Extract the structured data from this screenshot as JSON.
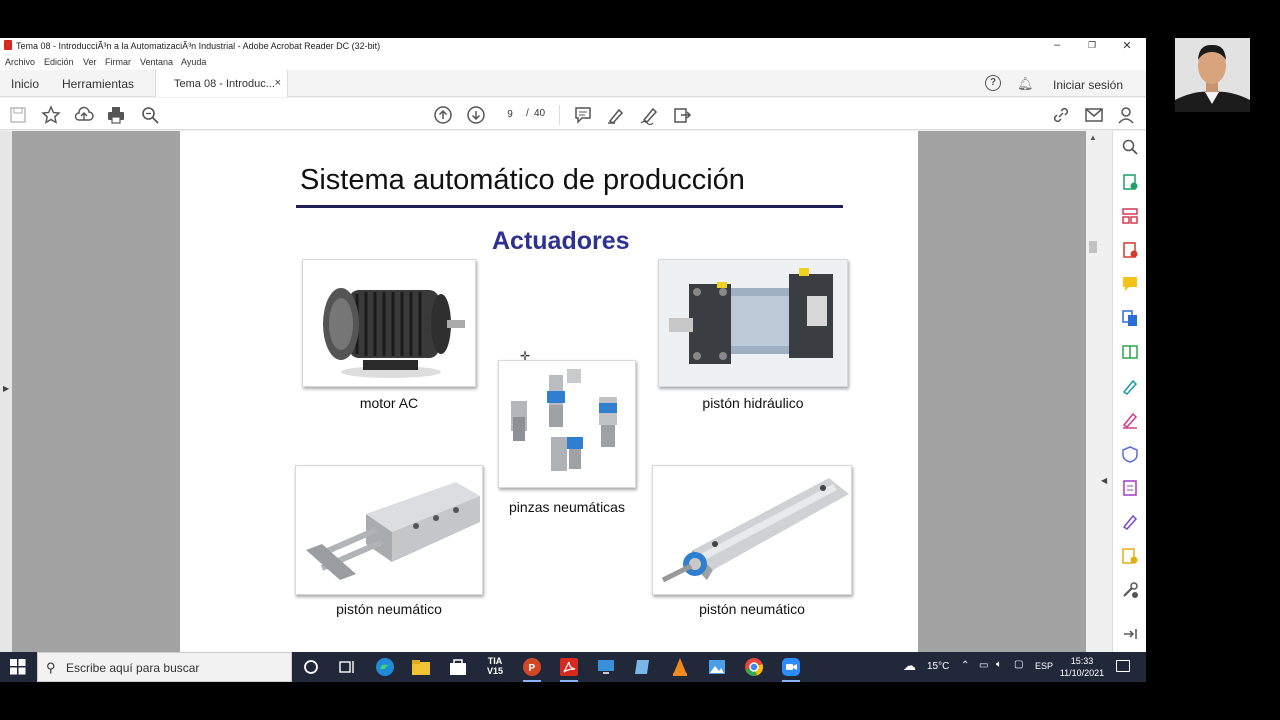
{
  "window": {
    "title": "Tema 08 - IntroducciÃ³n a la AutomatizaciÃ³n Industrial - Adobe Acrobat Reader DC (32-bit)",
    "controls": {
      "minimize": "–",
      "restore": "❐",
      "close": "✕"
    }
  },
  "menu": [
    "Archivo",
    "Edición",
    "Ver",
    "Firmar",
    "Ventana",
    "Ayuda"
  ],
  "tabs": {
    "home": "Inicio",
    "tools": "Herramientas",
    "document": "Tema 08 - Introduc...",
    "close": "×",
    "help": "?",
    "login": "Iniciar sesión"
  },
  "toolbar": {
    "current_page": "9",
    "separator": "/",
    "total_pages": "40"
  },
  "slide": {
    "title": "Sistema automático de producción",
    "section": "Actuadores",
    "captions": {
      "motor": "motor AC",
      "hydraulic": "pistón hidráulico",
      "grippers": "pinzas neumáticas",
      "pneumatic_left": "pistón neumático",
      "pneumatic_right": "pistón neumático"
    }
  },
  "taskbar": {
    "search_placeholder": "Escribe aquí para buscar",
    "tia_label_top": "TIA",
    "tia_label_bottom": "V15",
    "weather": "15°C",
    "language": "ESP",
    "time": "15:33",
    "date": "11/10/2021"
  },
  "colors": {
    "accent_title": "#2e3192",
    "rule": "#1f1f5a",
    "taskbar": "#20283a",
    "acrobat_red": "#d62a1e"
  }
}
